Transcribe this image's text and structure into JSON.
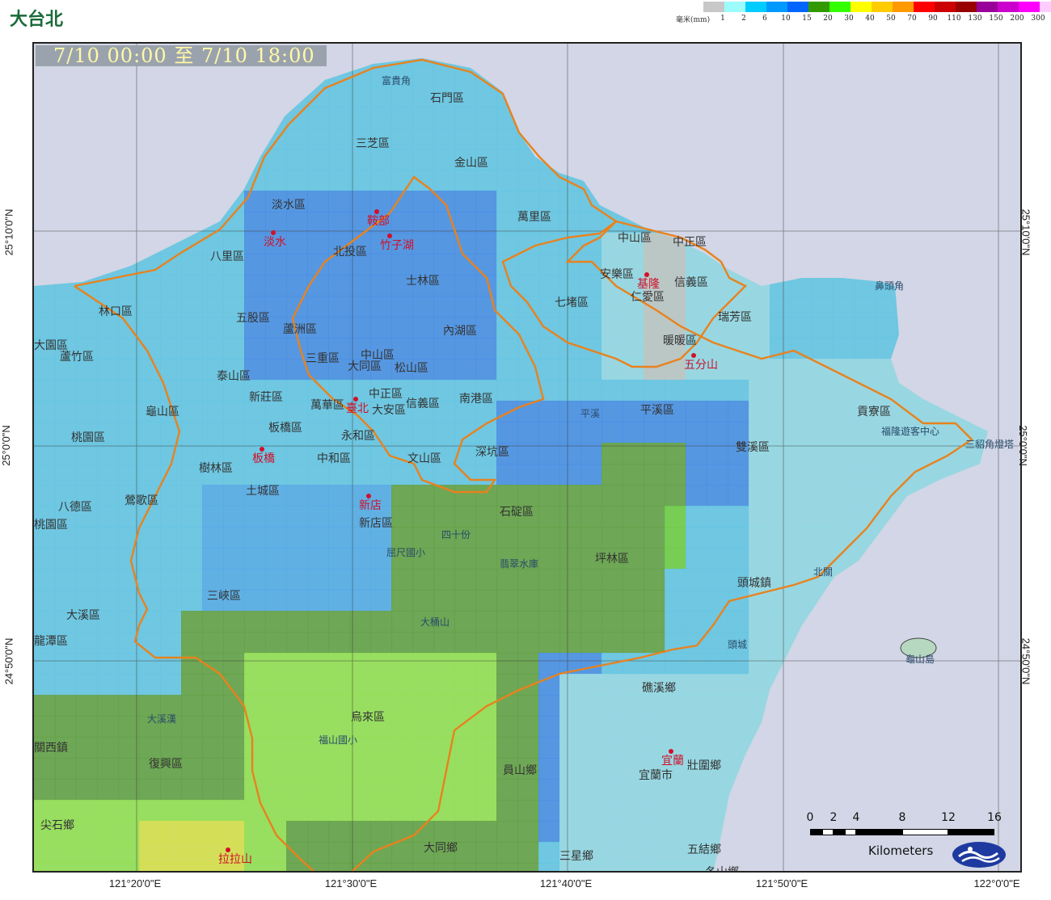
{
  "title": "大台北",
  "time_range": {
    "start": "7/10 00:00",
    "connector": "至",
    "end": "7/10 18:00"
  },
  "legend": {
    "unit_label": "毫米(mm)",
    "bins": [
      {
        "label": "1",
        "color": "#c8c8c8"
      },
      {
        "label": "2",
        "color": "#9cfcfc"
      },
      {
        "label": "6",
        "color": "#00ccff"
      },
      {
        "label": "10",
        "color": "#0099ff"
      },
      {
        "label": "15",
        "color": "#0066ff"
      },
      {
        "label": "20",
        "color": "#339900"
      },
      {
        "label": "30",
        "color": "#33ff00"
      },
      {
        "label": "40",
        "color": "#ffff00"
      },
      {
        "label": "50",
        "color": "#ffcc00"
      },
      {
        "label": "70",
        "color": "#ff9900"
      },
      {
        "label": "90",
        "color": "#ff0000"
      },
      {
        "label": "110",
        "color": "#cc0000"
      },
      {
        "label": "130",
        "color": "#990000"
      },
      {
        "label": "150",
        "color": "#990099"
      },
      {
        "label": "200",
        "color": "#cc00cc"
      },
      {
        "label": "300",
        "color": "#ff00ff"
      }
    ],
    "extra_top_color": "#ffccff"
  },
  "axes": {
    "longitude_labels": [
      "121°20'0\"E",
      "121°30'0\"E",
      "121°40'0\"E",
      "121°50'0\"E",
      "122°0'0\"E"
    ],
    "latitude_labels": [
      "25°10'0\"N",
      "25°0'0\"N",
      "24°50'0\"N"
    ]
  },
  "scale_bar": {
    "ticks": [
      "0",
      "2",
      "4",
      "8",
      "12",
      "16"
    ],
    "units": "Kilometers"
  },
  "places": {
    "districts": [
      "石門區",
      "三芝區",
      "淡水區",
      "北投區",
      "士林區",
      "八里區",
      "林口區",
      "五股區",
      "蘆洲區",
      "內湖區",
      "中山區",
      "松山區",
      "三重區",
      "大同區",
      "泰山區",
      "新莊區",
      "中正區",
      "萬華區",
      "大安區",
      "信義區",
      "南港區",
      "板橋區",
      "永和區",
      "中和區",
      "文山區",
      "深坑區",
      "樹林區",
      "土城區",
      "新店區",
      "石碇區",
      "平溪區",
      "雙溪區",
      "貢寮區",
      "瑞芳區",
      "暖暖區",
      "七堵區",
      "安樂區",
      "中山區",
      "信義區",
      "仁愛區",
      "中正區",
      "萬里區",
      "金山區",
      "蘆竹區",
      "龜山區",
      "桃園區",
      "八德區",
      "鶯歌區",
      "三峽區",
      "大溪區",
      "龍潭區",
      "關西鎮",
      "復興區",
      "尖石鄉",
      "烏來區",
      "坪林區",
      "頭城鎮",
      "礁溪鄉",
      "宜蘭市",
      "壯圍鄉",
      "員山鄉",
      "大同鄉",
      "三星鄉",
      "五結鄉",
      "冬山鄉",
      "大園區",
      "桃園區"
    ],
    "stations_red": [
      "鞍部",
      "竹子湖",
      "淡水",
      "基隆",
      "五分山",
      "臺北",
      "板橋",
      "新店",
      "宜蘭",
      "拉拉山"
    ],
    "landmarks": [
      "富貴角",
      "鼻頭角",
      "三貂角燈塔",
      "福隆遊客中心",
      "龜山島",
      "四十份",
      "翡翠水庫",
      "大桶山",
      "拉拉山",
      "福山國小",
      "五分山",
      "平溪",
      "屈尺國小",
      "北關",
      "頭城",
      "大溪漢"
    ]
  }
}
